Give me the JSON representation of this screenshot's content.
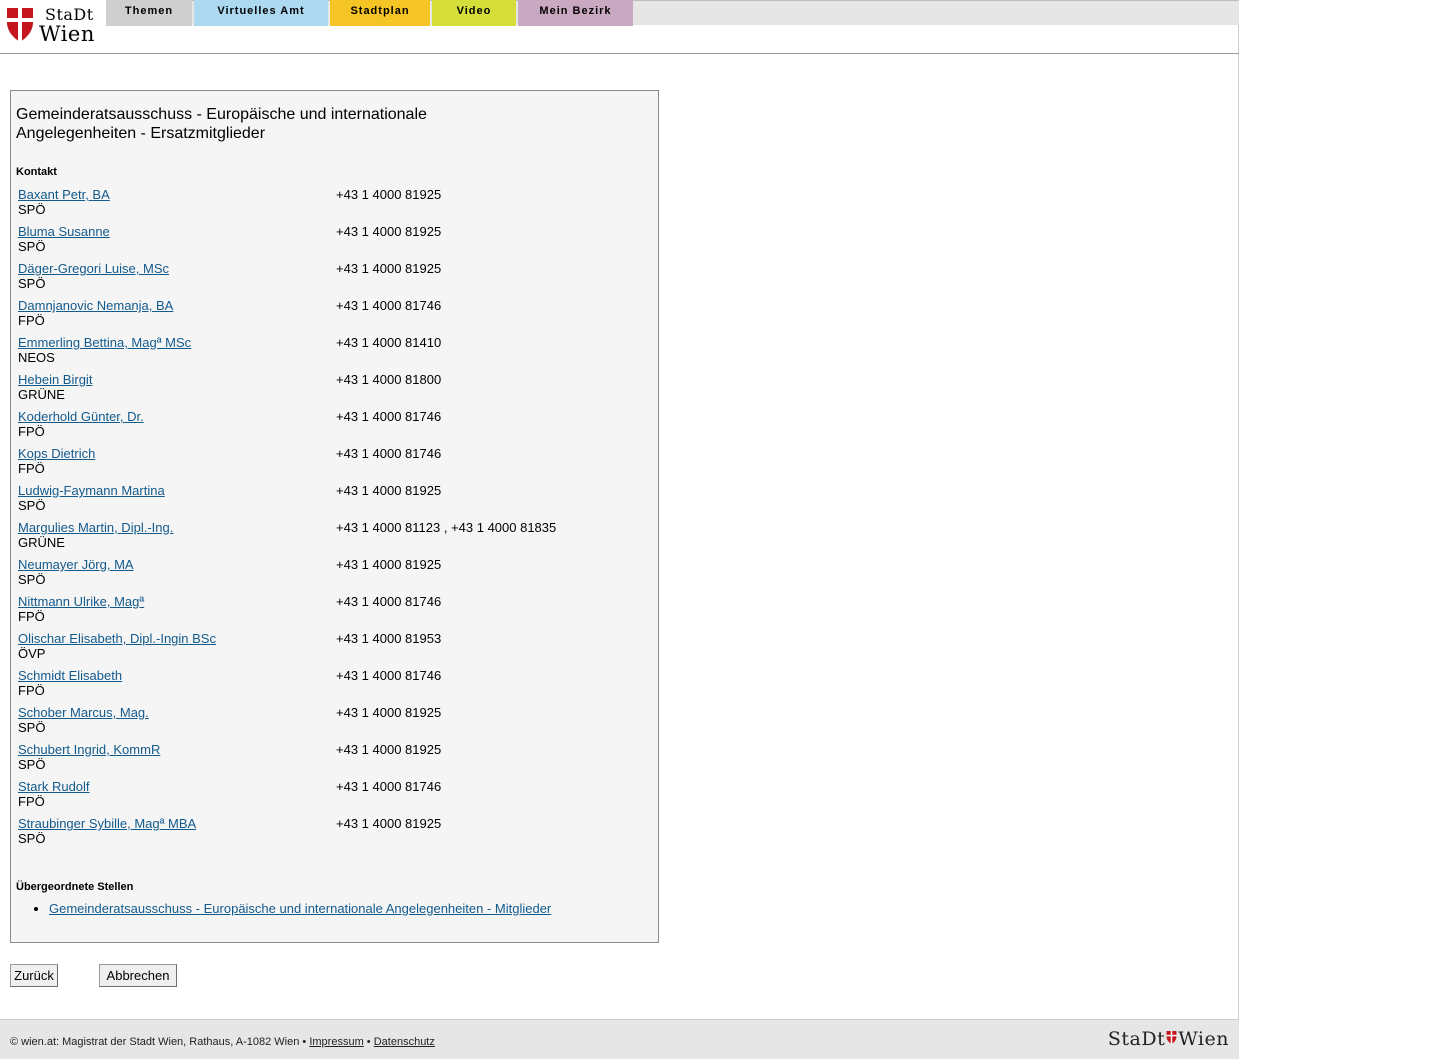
{
  "header": {
    "logo_stadt": "StaDt",
    "logo_wien": "Wien",
    "brand_color": "#c4161c",
    "tabs": [
      {
        "label": "Themen",
        "color": "#cfcfcf"
      },
      {
        "label": "Virtuelles Amt",
        "color": "#acd8f0"
      },
      {
        "label": "Stadtplan",
        "color": "#f5c525"
      },
      {
        "label": "Video",
        "color": "#d6df3a"
      },
      {
        "label": "Mein Bezirk",
        "color": "#c9a9c1"
      }
    ]
  },
  "main": {
    "title": "Gemeinderatsausschuss - Europäische und internationale Angelegenheiten - Ersatzmitglieder",
    "contact_label": "Kontakt",
    "link_color": "#135a8d",
    "contacts": [
      {
        "name": "Baxant Petr, BA",
        "party": "SPÖ",
        "phone": "+43 1 4000 81925"
      },
      {
        "name": "Bluma Susanne",
        "party": "SPÖ",
        "phone": "+43 1 4000 81925"
      },
      {
        "name": "Däger-Gregori Luise, MSc",
        "party": "SPÖ",
        "phone": "+43 1 4000 81925"
      },
      {
        "name": "Damnjanovic Nemanja, BA",
        "party": "FPÖ",
        "phone": "+43 1 4000 81746"
      },
      {
        "name": "Emmerling Bettina, Magª MSc",
        "party": "NEOS",
        "phone": "+43 1 4000 81410"
      },
      {
        "name": "Hebein Birgit",
        "party": "GRÜNE",
        "phone": "+43 1 4000 81800"
      },
      {
        "name": "Koderhold Günter, Dr.",
        "party": "FPÖ",
        "phone": "+43 1 4000 81746"
      },
      {
        "name": "Kops Dietrich",
        "party": "FPÖ",
        "phone": "+43 1 4000 81746"
      },
      {
        "name": "Ludwig-Faymann Martina",
        "party": "SPÖ",
        "phone": "+43 1 4000 81925"
      },
      {
        "name": "Margulies Martin, Dipl.-Ing.",
        "party": "GRÜNE",
        "phone": "+43 1 4000 81123 , +43 1 4000 81835"
      },
      {
        "name": "Neumayer Jörg, MA",
        "party": "SPÖ",
        "phone": "+43 1 4000 81925"
      },
      {
        "name": "Nittmann Ulrike, Magª",
        "party": "FPÖ",
        "phone": "+43 1 4000 81746"
      },
      {
        "name": "Olischar Elisabeth, Dipl.-Ingin BSc",
        "party": "ÖVP",
        "phone": "+43 1 4000 81953"
      },
      {
        "name": "Schmidt Elisabeth",
        "party": "FPÖ",
        "phone": "+43 1 4000 81746"
      },
      {
        "name": "Schober Marcus, Mag.",
        "party": "SPÖ",
        "phone": "+43 1 4000 81925"
      },
      {
        "name": "Schubert Ingrid, KommR",
        "party": "SPÖ",
        "phone": "+43 1 4000 81925"
      },
      {
        "name": "Stark Rudolf",
        "party": "FPÖ",
        "phone": "+43 1 4000 81746"
      },
      {
        "name": "Straubinger Sybille, Magª MBA",
        "party": "SPÖ",
        "phone": "+43 1 4000 81925"
      }
    ],
    "parent_label": "Übergeordnete Stellen",
    "parent_links": [
      "Gemeinderatsausschuss - Europäische und internationale Angelegenheiten - Mitglieder"
    ]
  },
  "actions": {
    "back_label": "Zurück",
    "cancel_label": "Abbrechen"
  },
  "footer": {
    "copyright": "© wien.at: Magistrat der Stadt Wien, Rathaus, A-1082 Wien •",
    "separator": "•",
    "impressum": "Impressum",
    "datenschutz": "Datenschutz",
    "logo_stadt": "StaDt",
    "logo_wien": "Wien"
  }
}
